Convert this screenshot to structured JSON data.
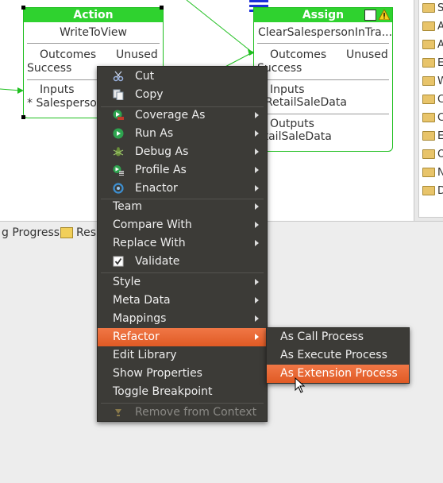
{
  "canvas": {
    "action_node": {
      "title": "Action",
      "name": "WriteToView",
      "outcomes_label": "Outcomes",
      "outcomes_value": "Unused",
      "outcome": "Success",
      "inputs_label": "Inputs",
      "input_item": "* Salesperson"
    },
    "assign_node": {
      "title": "Assign",
      "name": "ClearSalespersonInTra...",
      "outcomes_label": "Outcomes",
      "outcomes_value": "Unused",
      "outcome": "Success",
      "inputs_label": "Inputs",
      "input_item": "RetailSaleData",
      "outputs_label": "Outputs",
      "output_item": "etailSaleData"
    }
  },
  "tree": {
    "items": [
      "St",
      "A",
      "A",
      "Ex",
      "W",
      "Co",
      "Co",
      "Ev",
      "O",
      "N",
      "Da"
    ]
  },
  "tabstrip": {
    "progress_label": "g Progress",
    "second_label": "Resu"
  },
  "context_menu": {
    "items": [
      {
        "label": "Cut",
        "icon": "scissors-icon"
      },
      {
        "label": "Copy",
        "icon": "copy-icon"
      },
      {
        "label": "Coverage As",
        "icon": "coverage-icon",
        "submenu": true
      },
      {
        "label": "Run As",
        "icon": "run-icon",
        "submenu": true
      },
      {
        "label": "Debug As",
        "icon": "debug-icon",
        "submenu": true
      },
      {
        "label": "Profile As",
        "icon": "profile-icon",
        "submenu": true
      },
      {
        "label": "Enactor",
        "icon": "enactor-icon",
        "submenu": true
      },
      {
        "label": "Team",
        "submenu": true
      },
      {
        "label": "Compare With",
        "submenu": true
      },
      {
        "label": "Replace With",
        "submenu": true
      },
      {
        "label": "Validate",
        "icon": "checkbox-icon",
        "checked": true
      },
      {
        "label": "Style",
        "submenu": true
      },
      {
        "label": "Meta Data",
        "submenu": true
      },
      {
        "label": "Mappings",
        "submenu": true
      },
      {
        "label": "Refactor",
        "submenu": true,
        "highlighted": true
      },
      {
        "label": "Edit Library"
      },
      {
        "label": "Show Properties"
      },
      {
        "label": "Toggle Breakpoint"
      },
      {
        "label": "Remove from Context",
        "icon": "remove-context-icon",
        "disabled": true
      }
    ]
  },
  "submenu": {
    "items": [
      {
        "label": "As Call Process"
      },
      {
        "label": "As Execute Process"
      },
      {
        "label": "As Extension Process",
        "highlighted": true
      }
    ]
  },
  "colors": {
    "menu_bg": "#3c3b37",
    "highlight": "#e8683a",
    "node_green": "#2fd22f"
  }
}
